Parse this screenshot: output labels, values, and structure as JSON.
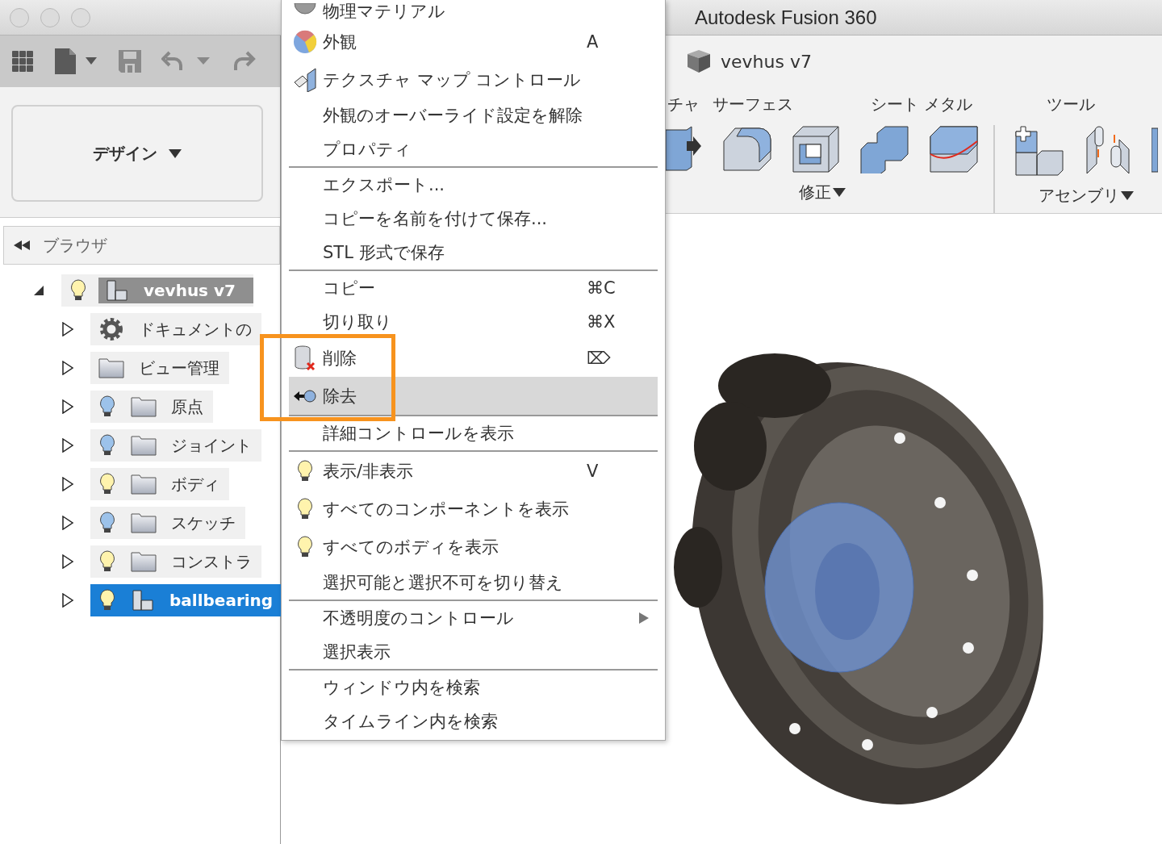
{
  "window": {
    "title": "Autodesk Fusion 360"
  },
  "workspace": {
    "label": "デザイン"
  },
  "browser": {
    "title": "ブラウザ",
    "root": {
      "label": "vevhus v7",
      "active": true,
      "expanded": true,
      "visible": true,
      "children": [
        {
          "label": "ドキュメントの",
          "kind": "gear",
          "expanded": false,
          "selected": false
        },
        {
          "label": "ビュー管理",
          "kind": "folder",
          "expanded": false,
          "selected": false
        },
        {
          "label": "原点",
          "kind": "folder",
          "visible": false,
          "expanded": false,
          "selected": false
        },
        {
          "label": "ジョイント",
          "kind": "folder",
          "visible": false,
          "expanded": false,
          "selected": false
        },
        {
          "label": "ボディ",
          "kind": "folder",
          "visible": true,
          "expanded": false,
          "selected": false
        },
        {
          "label": "スケッチ",
          "kind": "folder",
          "visible": false,
          "expanded": false,
          "selected": false
        },
        {
          "label": "コンストラ",
          "kind": "folder",
          "visible": true,
          "expanded": false,
          "selected": false
        },
        {
          "label": "ballbearing",
          "kind": "component",
          "visible": true,
          "expanded": false,
          "selected": true
        }
      ]
    }
  },
  "document": {
    "name": "vevhus v7"
  },
  "ribbon_tabs": [
    "チャ",
    "サーフェス",
    "シート メタル",
    "ツール"
  ],
  "tool_groups": [
    {
      "label": "修正",
      "tools": [
        {
          "kind": "presspull"
        },
        {
          "kind": "fillet"
        },
        {
          "kind": "shell"
        },
        {
          "kind": "combine"
        },
        {
          "kind": "split"
        }
      ]
    },
    {
      "label": "アセンブリ",
      "tools": [
        {
          "kind": "newcomponent"
        },
        {
          "kind": "joint"
        },
        {
          "kind": "partial"
        }
      ]
    }
  ],
  "context_menu": [
    {
      "kind": "material",
      "label": "物理マテリアル",
      "selected": false
    },
    {
      "kind": "appearance",
      "label": "外観",
      "shortcut": "A",
      "selected": false
    },
    {
      "kind": "texture",
      "label": "テクスチャ マップ コントロール",
      "selected": false
    },
    {
      "kind": "plain",
      "label": "外観のオーバーライド設定を解除",
      "selected": false
    },
    {
      "kind": "plain",
      "label": "プロパティ",
      "selected": false
    },
    {
      "kind": "separator"
    },
    {
      "kind": "plain",
      "label": "エクスポート...",
      "selected": false
    },
    {
      "kind": "plain",
      "label": "コピーを名前を付けて保存...",
      "selected": false
    },
    {
      "kind": "plain",
      "label": "STL 形式で保存",
      "selected": false
    },
    {
      "kind": "separator"
    },
    {
      "kind": "plain",
      "label": "コピー",
      "shortcut": "⌘C",
      "selected": false
    },
    {
      "kind": "plain",
      "label": "切り取り",
      "shortcut": "⌘X",
      "selected": false
    },
    {
      "kind": "delete",
      "label": "削除",
      "shortcut": "⌦",
      "selected": false
    },
    {
      "kind": "remove",
      "label": "除去",
      "selected": true
    },
    {
      "kind": "separator"
    },
    {
      "kind": "plain",
      "label": "詳細コントロールを表示",
      "selected": false
    },
    {
      "kind": "separator"
    },
    {
      "kind": "bulb",
      "label": "表示/非表示",
      "shortcut": "V",
      "selected": false
    },
    {
      "kind": "bulb",
      "label": "すべてのコンポーネントを表示",
      "selected": false
    },
    {
      "kind": "bulb",
      "label": "すべてのボディを表示",
      "selected": false
    },
    {
      "kind": "plain",
      "label": "選択可能と選択不可を切り替え",
      "selected": false
    },
    {
      "kind": "separator"
    },
    {
      "kind": "plain",
      "label": "不透明度のコントロール",
      "submenu": true,
      "selected": false
    },
    {
      "kind": "plain",
      "label": "選択表示",
      "selected": false
    },
    {
      "kind": "separator"
    },
    {
      "kind": "plain",
      "label": "ウィンドウ内を検索",
      "selected": false
    },
    {
      "kind": "plain",
      "label": "タイムライン内を検索",
      "selected": false
    }
  ]
}
